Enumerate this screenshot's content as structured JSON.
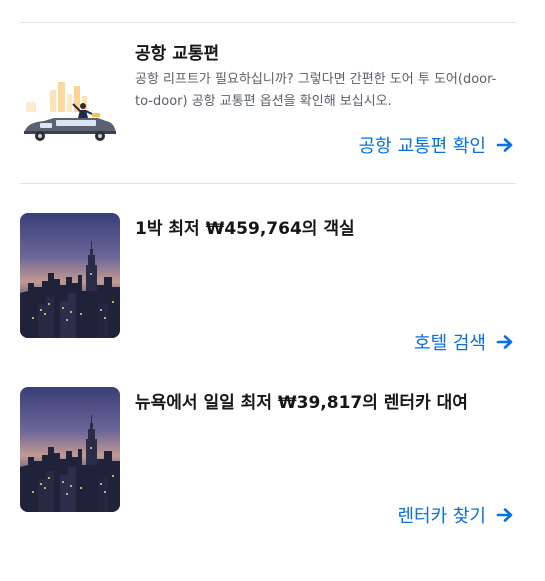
{
  "airport": {
    "title": "공항 교통편",
    "description": "공항 리프트가 필요하십니까? 그렇다면 간편한 도어 투 도어(door-to-door) 공항 교통편 옵션을 확인해 보십시오.",
    "cta_label": "공항 교통편 확인",
    "icon": "limousine-illustration"
  },
  "hotel": {
    "title": "1박 최저 ₩459,764의 객실",
    "cta_label": "호텔 검색",
    "image": "new-york-skyline-photo"
  },
  "car": {
    "title": "뉴욕에서 일일 최저 ₩39,817의 렌터카 대여",
    "cta_label": "렌터카 찾기",
    "image": "new-york-skyline-photo"
  },
  "colors": {
    "accent": "#0770e3",
    "text": "#161616",
    "muted": "#5a5f6b",
    "divider": "#e2e4e8"
  }
}
